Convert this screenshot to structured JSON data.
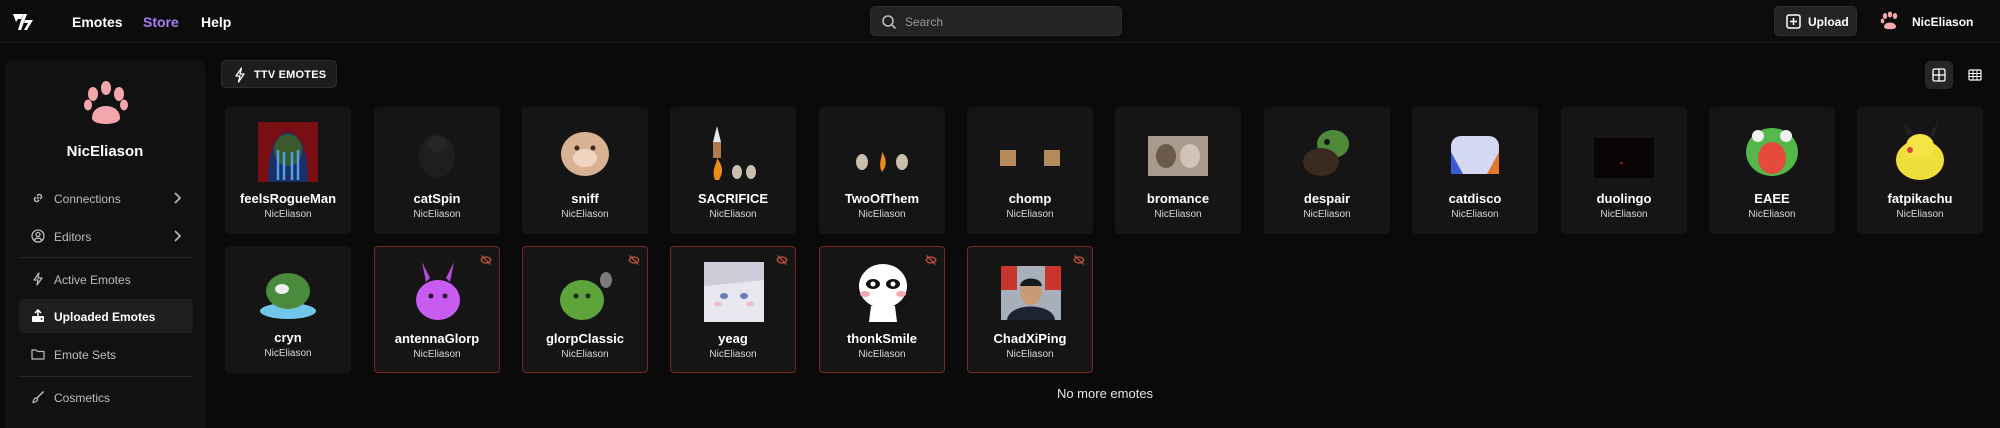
{
  "topbar": {
    "logo": "7tv-logo",
    "nav": [
      {
        "label": "Emotes",
        "name": "nav-emotes"
      },
      {
        "label": "Store",
        "name": "nav-store"
      },
      {
        "label": "Help",
        "name": "nav-help"
      }
    ],
    "search_placeholder": "Search",
    "upload_label": "Upload",
    "username": "NicEliason",
    "accent": "#a97ef7"
  },
  "sidebar": {
    "username": "NicEliason",
    "avatar_icon": "paw-icon",
    "avatar_color": "#f4a6ad",
    "items": [
      {
        "label": "Connections",
        "icon": "link-icon"
      },
      {
        "label": "Editors",
        "icon": "user-circle-icon"
      },
      {
        "label": "Active Emotes",
        "icon": "lightning-icon"
      },
      {
        "label": "Uploaded Emotes",
        "icon": "upload-tray-icon"
      },
      {
        "label": "Emote Sets",
        "icon": "folder-icon"
      },
      {
        "label": "Cosmetics",
        "icon": "paintbrush-icon"
      }
    ]
  },
  "main": {
    "filter_label": "TTV EMOTES",
    "emotes": [
      {
        "name": "feelsRogueMan",
        "owner": "NicEliason",
        "hidden": false
      },
      {
        "name": "catSpin",
        "owner": "NicEliason",
        "hidden": false
      },
      {
        "name": "sniff",
        "owner": "NicEliason",
        "hidden": false
      },
      {
        "name": "SACRIFICE",
        "owner": "NicEliason",
        "hidden": false
      },
      {
        "name": "TwoOfThem",
        "owner": "NicEliason",
        "hidden": false
      },
      {
        "name": "chomp",
        "owner": "NicEliason",
        "hidden": false
      },
      {
        "name": "bromance",
        "owner": "NicEliason",
        "hidden": false
      },
      {
        "name": "despair",
        "owner": "NicEliason",
        "hidden": false
      },
      {
        "name": "catdisco",
        "owner": "NicEliason",
        "hidden": false
      },
      {
        "name": "duolingo",
        "owner": "NicEliason",
        "hidden": false
      },
      {
        "name": "EAEE",
        "owner": "NicEliason",
        "hidden": false
      },
      {
        "name": "fatpikachu",
        "owner": "NicEliason",
        "hidden": false
      },
      {
        "name": "cryn",
        "owner": "NicEliason",
        "hidden": false
      },
      {
        "name": "antennaGlorp",
        "owner": "NicEliason",
        "hidden": true
      },
      {
        "name": "glorpClassic",
        "owner": "NicEliason",
        "hidden": true
      },
      {
        "name": "yeag",
        "owner": "NicEliason",
        "hidden": true
      },
      {
        "name": "thonkSmile",
        "owner": "NicEliason",
        "hidden": true
      },
      {
        "name": "ChadXiPing",
        "owner": "NicEliason",
        "hidden": true
      }
    ],
    "end_text": "No more emotes"
  }
}
